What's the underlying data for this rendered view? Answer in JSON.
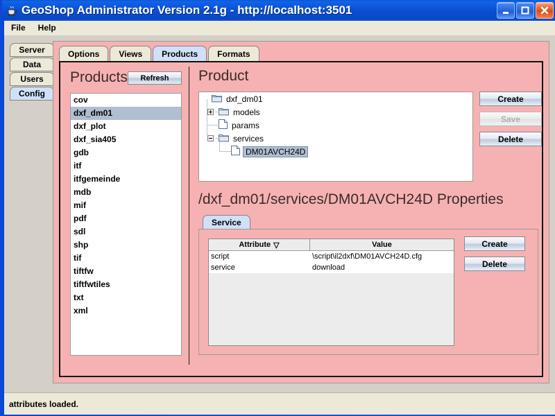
{
  "window": {
    "title": "GeoShop Administrator Version 2.1g - http://localhost:3501",
    "app_icon": "coffee-cup-icon",
    "minimize_label": "Minimize",
    "maximize_label": "Maximize",
    "close_label": "Close"
  },
  "menubar": {
    "items": [
      {
        "label": "File"
      },
      {
        "label": "Help"
      }
    ]
  },
  "vertical_tabs": {
    "items": [
      {
        "label": "Server",
        "selected": false
      },
      {
        "label": "Data",
        "selected": false
      },
      {
        "label": "Users",
        "selected": false
      },
      {
        "label": "Config",
        "selected": true
      }
    ]
  },
  "main_tabs": {
    "items": [
      {
        "label": "Options",
        "selected": false
      },
      {
        "label": "Views",
        "selected": false
      },
      {
        "label": "Products",
        "selected": true
      },
      {
        "label": "Formats",
        "selected": false
      }
    ]
  },
  "products_panel": {
    "heading": "Products",
    "refresh_label": "Refresh",
    "items": [
      {
        "label": "cov",
        "selected": false
      },
      {
        "label": "dxf_dm01",
        "selected": true
      },
      {
        "label": "dxf_plot",
        "selected": false
      },
      {
        "label": "dxf_sia405",
        "selected": false
      },
      {
        "label": "gdb",
        "selected": false
      },
      {
        "label": "itf",
        "selected": false
      },
      {
        "label": "itfgemeinde",
        "selected": false
      },
      {
        "label": "mdb",
        "selected": false
      },
      {
        "label": "mif",
        "selected": false
      },
      {
        "label": "pdf",
        "selected": false
      },
      {
        "label": "sdl",
        "selected": false
      },
      {
        "label": "shp",
        "selected": false
      },
      {
        "label": "tif",
        "selected": false
      },
      {
        "label": "tiftfw",
        "selected": false
      },
      {
        "label": "tiftfwtiles",
        "selected": false
      },
      {
        "label": "txt",
        "selected": false
      },
      {
        "label": "xml",
        "selected": false
      }
    ]
  },
  "product_panel": {
    "heading": "Product",
    "tree": [
      {
        "label": "dxf_dm01",
        "depth": 0,
        "icon": "folder-icon",
        "handle": "none",
        "selected": false
      },
      {
        "label": "models",
        "depth": 1,
        "icon": "folder-icon",
        "handle": "plus",
        "selected": false
      },
      {
        "label": "params",
        "depth": 1,
        "icon": "file-icon",
        "handle": "none",
        "selected": false
      },
      {
        "label": "services",
        "depth": 1,
        "icon": "folder-icon",
        "handle": "minus",
        "selected": false
      },
      {
        "label": "DM01AVCH24D",
        "depth": 2,
        "icon": "file-icon",
        "handle": "none",
        "selected": true
      }
    ],
    "buttons": [
      {
        "label": "Create",
        "enabled": true
      },
      {
        "label": "Save",
        "enabled": false
      },
      {
        "label": "Delete",
        "enabled": true
      }
    ]
  },
  "properties_panel": {
    "heading": "/dxf_dm01/services/DM01AVCH24D Properties",
    "tabs": [
      {
        "label": "Service",
        "selected": true
      }
    ],
    "table": {
      "columns": [
        "Attribute",
        "Value"
      ],
      "sort_column": "Attribute",
      "sort_glyph": "▽",
      "rows": [
        {
          "attribute": "script",
          "value": "\\script\\il2dxf\\DM01AVCH24D.cfg"
        },
        {
          "attribute": "service",
          "value": "download"
        }
      ]
    },
    "buttons": [
      {
        "label": "Create",
        "enabled": true
      },
      {
        "label": "Delete",
        "enabled": true
      }
    ]
  },
  "statusbar": {
    "message": "attributes loaded."
  },
  "colors": {
    "titlebar": "#0b4fd2",
    "panel_pink": "#f6b2b2",
    "tab_selected": "#cfe0f7",
    "selection": "#b0bed2",
    "chrome": "#ece9d8"
  }
}
